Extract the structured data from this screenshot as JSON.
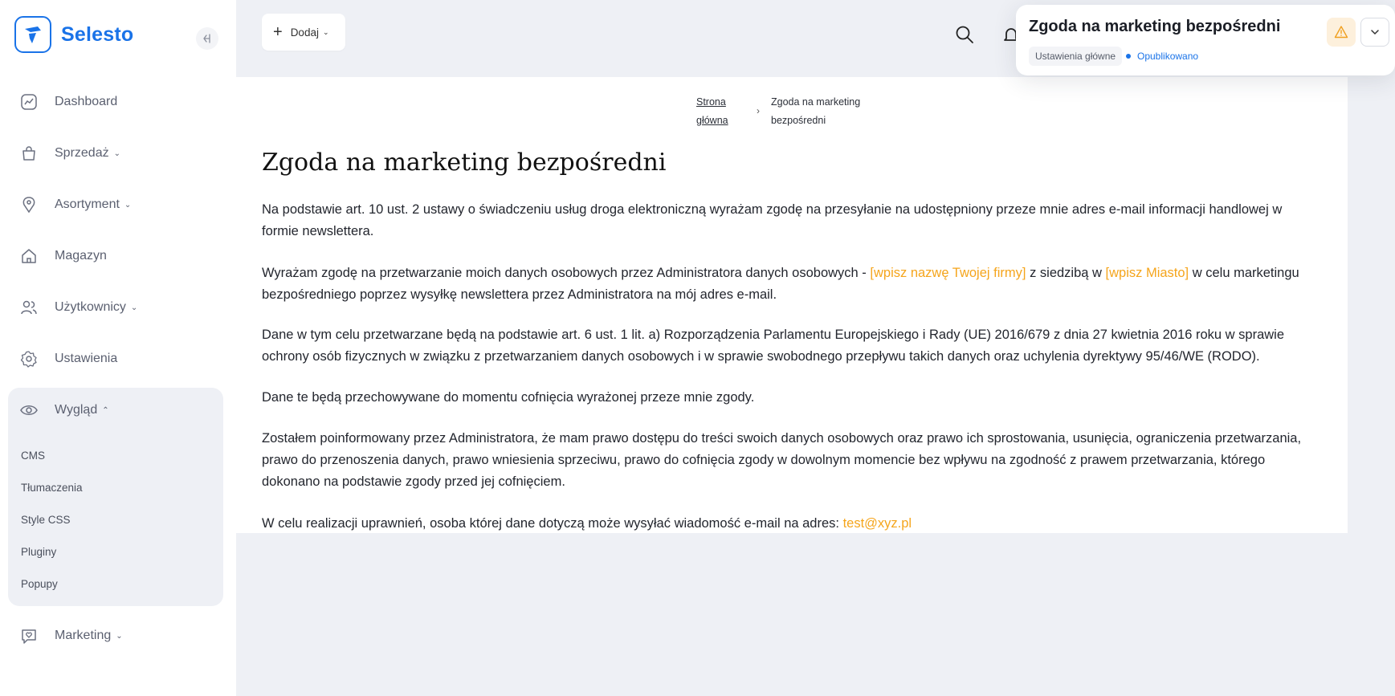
{
  "app": {
    "brand": "Selesto"
  },
  "sidebar": {
    "items": [
      {
        "label": "Dashboard",
        "icon": "chart-line-icon"
      },
      {
        "label": "Sprzedaż",
        "icon": "shopping-bag-icon"
      },
      {
        "label": "Asortyment",
        "icon": "tag-icon"
      },
      {
        "label": "Magazyn",
        "icon": "warehouse-icon"
      },
      {
        "label": "Użytkownicy",
        "icon": "users-icon"
      },
      {
        "label": "Ustawienia",
        "icon": "gear-icon"
      },
      {
        "label": "Wygląd",
        "icon": "eye-icon"
      },
      {
        "label": "Marketing",
        "icon": "heart-chat-icon"
      }
    ],
    "wyglad_subitems": [
      "CMS",
      "Tłumaczenia",
      "Style CSS",
      "Pluginy",
      "Popupy"
    ]
  },
  "toolbar": {
    "add_label": "Dodaj"
  },
  "breadcrumb": {
    "home_line1": "Strona",
    "home_line2": "główna",
    "current_line1": "Zgoda na marketing",
    "current_line2": "bezpośredni"
  },
  "page": {
    "title": "Zgoda na marketing bezpośredni",
    "p1": "Na podstawie art. 10 ust. 2 ustawy o świadczeniu usług droga elektroniczną wyrażam zgodę na przesyłanie na udostępniony przeze mnie adres e-mail informacji handlowej w formie newslettera.",
    "p2_a": "Wyrażam zgodę na przetwarzanie moich danych osobowych przez Administratora danych osobowych - ",
    "p2_firm": "[wpisz nazwę Twojej firmy]",
    "p2_b": " z siedzibą w ",
    "p2_city": "[wpisz Miasto]",
    "p2_c": " w celu marketingu bezpośredniego poprzez wysyłkę newslettera przez Administratora na mój adres e-mail.",
    "p3": "Dane w tym celu przetwarzane będą na podstawie art. 6 ust. 1 lit. a) Rozporządzenia Parlamentu Europejskiego i Rady (UE) 2016/679 z dnia 27 kwietnia 2016 roku w sprawie ochrony osób fizycznych w związku z przetwarzaniem danych osobowych i w sprawie swobodnego przepływu takich danych oraz uchylenia dyrektywy 95/46/WE (RODO).",
    "p4": "Dane te będą przechowywane do momentu cofnięcia wyrażonej przeze mnie zgody.",
    "p5": "Zostałem poinformowany przez Administratora, że mam prawo dostępu do treści swoich danych osobowych oraz prawo ich sprostowania, usunięcia, ograniczenia przetwarzania, prawo do przenoszenia danych, prawo wniesienia sprzeciwu, prawo do cofnięcia zgody w dowolnym momencie bez wpływu na zgodność z prawem przetwarzania, którego dokonano na podstawie zgody przed jej cofnięciem.",
    "p6_a": "W celu realizacji uprawnień, osoba której dane dotyczą może wysyłać wiadomość e-mail na adres: ",
    "p6_email": "test@xyz.pl"
  },
  "float_header": {
    "title": "Zgoda na marketing bezpośredni",
    "tag": "Ustawienia główne",
    "status": "Opublikowano"
  },
  "colors": {
    "accent": "#1a73e8",
    "highlight": "#f5a51c",
    "warning_bg": "#fdf0dc",
    "page_bg": "#eef0f5"
  }
}
